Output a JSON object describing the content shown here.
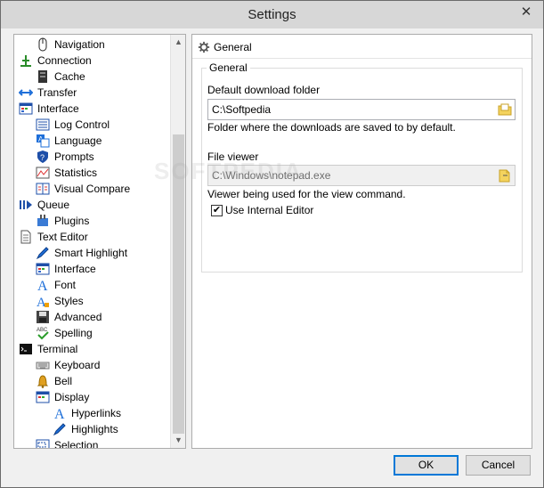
{
  "window": {
    "title": "Settings"
  },
  "titlebar": {
    "close_glyph": "✕"
  },
  "tree": {
    "items": [
      {
        "label": "Navigation",
        "icon": "mouse-icon"
      },
      {
        "label": "Connection",
        "icon": "connection-icon"
      },
      {
        "label": "Cache",
        "icon": "cache-icon"
      },
      {
        "label": "Transfer",
        "icon": "transfer-arrows-icon"
      },
      {
        "label": "Interface",
        "icon": "interface-icon"
      },
      {
        "label": "Log Control",
        "icon": "log-icon"
      },
      {
        "label": "Language",
        "icon": "language-icon"
      },
      {
        "label": "Prompts",
        "icon": "shield-question-icon"
      },
      {
        "label": "Statistics",
        "icon": "statistics-icon"
      },
      {
        "label": "Visual Compare",
        "icon": "visual-compare-icon"
      },
      {
        "label": "Queue",
        "icon": "queue-icon"
      },
      {
        "label": "Plugins",
        "icon": "plugins-icon"
      },
      {
        "label": "Text Editor",
        "icon": "text-document-icon"
      },
      {
        "label": "Smart Highlight",
        "icon": "pen-icon"
      },
      {
        "label": "Interface",
        "icon": "interface-icon"
      },
      {
        "label": "Font",
        "icon": "font-icon"
      },
      {
        "label": "Styles",
        "icon": "styles-icon"
      },
      {
        "label": "Advanced",
        "icon": "floppy-disk-icon"
      },
      {
        "label": "Spelling",
        "icon": "spelling-check-icon"
      },
      {
        "label": "Terminal",
        "icon": "terminal-icon"
      },
      {
        "label": "Keyboard",
        "icon": "keyboard-icon"
      },
      {
        "label": "Bell",
        "icon": "bell-icon"
      },
      {
        "label": "Display",
        "icon": "display-icon"
      },
      {
        "label": "Hyperlinks",
        "icon": "font-icon"
      },
      {
        "label": "Highlights",
        "icon": "pen-icon"
      },
      {
        "label": "Selection",
        "icon": "selection-icon"
      }
    ]
  },
  "panel": {
    "header": "General",
    "group_title": "General",
    "download_folder": {
      "label": "Default download folder",
      "value": "C:\\Softpedia",
      "help": "Folder where the downloads are saved to by default."
    },
    "file_viewer": {
      "label": "File viewer",
      "value": "C:\\Windows\\notepad.exe",
      "help": "Viewer being used for the view command."
    },
    "internal_editor": {
      "label": "Use Internal Editor",
      "checked_glyph": "✔"
    }
  },
  "watermark": "SOFTPEDIA",
  "buttons": {
    "ok": "OK",
    "cancel": "Cancel"
  }
}
